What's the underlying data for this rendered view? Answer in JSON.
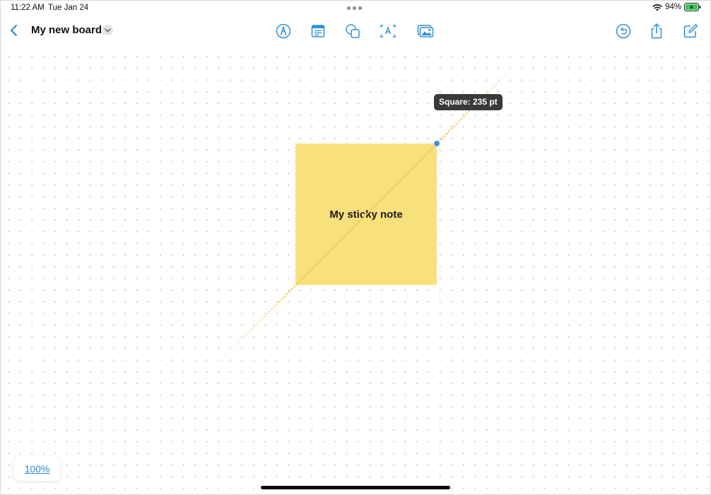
{
  "status_bar": {
    "time": "11:22 AM",
    "date": "Tue Jan 24",
    "battery_percent": "94%",
    "icons": [
      "wifi-icon",
      "battery-charging-icon"
    ]
  },
  "toolbar": {
    "back_icon": "chevron-left-icon",
    "title": "My new board",
    "title_menu_icon": "chevron-down-icon",
    "tools": [
      {
        "name": "pen-tool",
        "icon": "pen-circle-icon"
      },
      {
        "name": "sticky-note-tool",
        "icon": "note-icon"
      },
      {
        "name": "shapes-tool",
        "icon": "shapes-icon"
      },
      {
        "name": "text-box-tool",
        "icon": "text-box-icon"
      },
      {
        "name": "media-tool",
        "icon": "photo-icon"
      }
    ],
    "right_actions": [
      {
        "name": "undo",
        "icon": "undo-icon"
      },
      {
        "name": "share",
        "icon": "share-icon"
      },
      {
        "name": "new-board",
        "icon": "compose-icon"
      }
    ]
  },
  "canvas": {
    "sticky_note": {
      "text": "My sticky note",
      "color": "#F8E07D"
    },
    "size_tooltip": "Square: 235 pt",
    "guide_color": "#F2C94C",
    "handle_color": "#4A90D9"
  },
  "zoom": {
    "label": "100%"
  },
  "colors": {
    "accent": "#2F8FD6"
  }
}
